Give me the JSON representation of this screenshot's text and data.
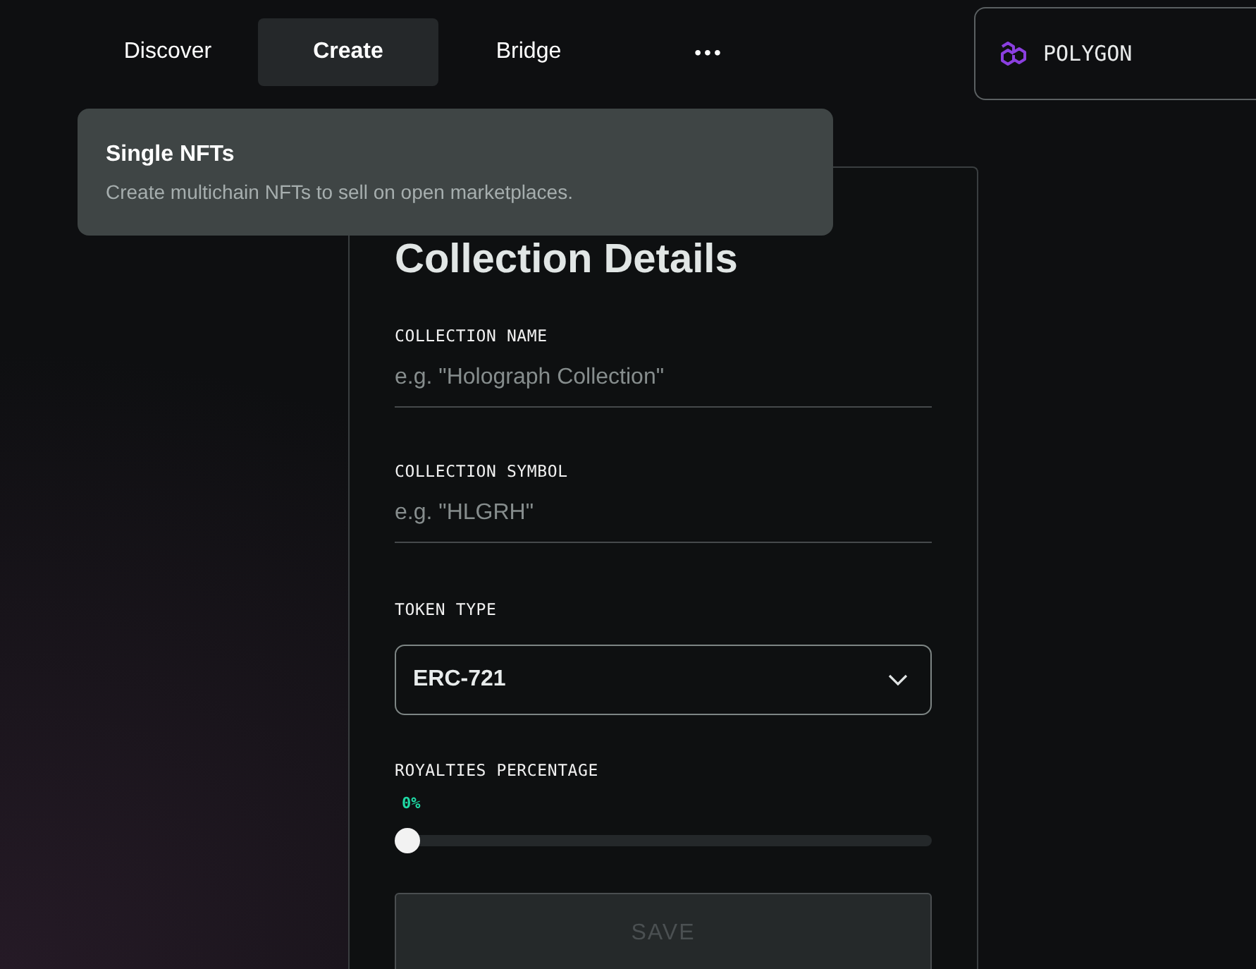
{
  "nav": {
    "tabs": [
      {
        "label": "Discover",
        "selected": false
      },
      {
        "label": "Create",
        "selected": true
      },
      {
        "label": "Bridge",
        "selected": false
      }
    ],
    "more": "•••",
    "network": {
      "label": "POLYGON"
    }
  },
  "menu": {
    "items": [
      {
        "title": "Single NFTs",
        "description": "Create multichain NFTs to sell on open marketplaces."
      }
    ]
  },
  "form": {
    "title": "Collection Details",
    "fields": [
      {
        "kind": "text",
        "label": "COLLECTION NAME",
        "placeholder": "e.g. \"Holograph Collection\""
      },
      {
        "kind": "text",
        "label": "COLLECTION SYMBOL",
        "placeholder": "e.g. \"HLGRH\""
      },
      {
        "kind": "select",
        "label": "TOKEN TYPE",
        "value": "ERC-721"
      },
      {
        "kind": "slider",
        "label": "ROYALTIES PERCENTAGE",
        "reading": "0%",
        "level": 0
      }
    ],
    "save": {
      "label": "SAVE",
      "disabled": true
    }
  }
}
